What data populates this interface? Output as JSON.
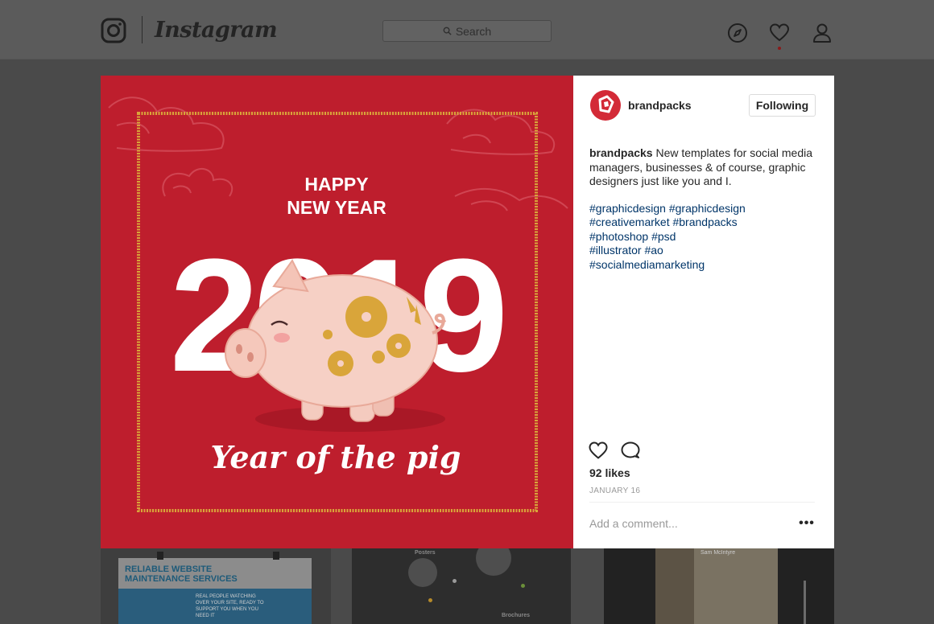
{
  "nav": {
    "brand": "Instagram",
    "search_placeholder": "Search",
    "icons": [
      "instagram-glyph-icon",
      "compass-icon",
      "heart-icon",
      "person-icon"
    ]
  },
  "post": {
    "artwork": {
      "headline_line1": "HAPPY",
      "headline_line2": "NEW YEAR",
      "year": "2019",
      "tagline": "Year of the pig",
      "colors": {
        "background": "#be1e2d",
        "gold": "#d9a53a",
        "text": "#ffffff"
      }
    },
    "author": "brandpacks",
    "follow_label": "Following",
    "caption_author": "brandpacks",
    "caption_text": "New templates for social media managers, businesses & of course, graphic designers just like you and I.",
    "hashtags": [
      "#graphicdesign #graphicdesign",
      "#creativemarket #brandpacks",
      "#photoshop #psd",
      "#illustrator #ao",
      "#socialmediamarketing"
    ],
    "likes": "92 likes",
    "date": "January 16",
    "comment_placeholder": "Add a comment...",
    "more_label": "•••"
  },
  "feed_tiles": {
    "tile1_title_line1": "Reliable website",
    "tile1_title_line2": "maintenance services",
    "tile1_body": "Real people watching over your site, ready to support you when you need it",
    "tile2_label_top": "Posters",
    "tile2_label_bottom": "Brochures",
    "tile3_name": "Sam McIntyre"
  }
}
